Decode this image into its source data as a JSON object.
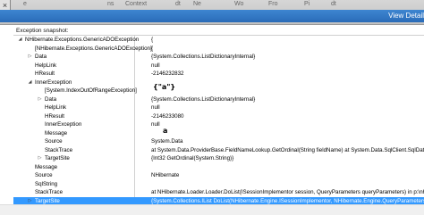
{
  "window": {
    "close_glyph": "×",
    "background_fragments": [
      "e",
      "ns",
      "Context",
      "dt",
      "Ne",
      "Wo",
      "Fro",
      "Pi",
      "dt"
    ],
    "title": "View Detail"
  },
  "snapshot_label": "Exception snapshot:",
  "rows": [
    {
      "indent": 0,
      "expander": "minus",
      "name": "NHibernate.Exceptions.GenericADOException",
      "value": "{"
    },
    {
      "indent": 1,
      "expander": "",
      "name": "[NHibernate.Exceptions.GenericADOException]",
      "value": "{"
    },
    {
      "indent": 1,
      "expander": "plus",
      "name": "Data",
      "value": "{System.Collections.ListDictionaryInternal}"
    },
    {
      "indent": 1,
      "expander": "",
      "name": "HelpLink",
      "value": "null"
    },
    {
      "indent": 1,
      "expander": "",
      "name": "HResult",
      "value": "-2146232832"
    },
    {
      "indent": 1,
      "expander": "minus",
      "name": "InnerException",
      "value": ""
    },
    {
      "indent": 2,
      "expander": "",
      "name": "[System.IndexOutOfRangeException]",
      "value": ""
    },
    {
      "indent": 2,
      "expander": "plus",
      "name": "Data",
      "value": "{System.Collections.ListDictionaryInternal}"
    },
    {
      "indent": 2,
      "expander": "",
      "name": "HelpLink",
      "value": "null"
    },
    {
      "indent": 2,
      "expander": "",
      "name": "HResult",
      "value": "-2146233080"
    },
    {
      "indent": 2,
      "expander": "",
      "name": "InnerException",
      "value": "null"
    },
    {
      "indent": 2,
      "expander": "",
      "name": "Message",
      "value": ""
    },
    {
      "indent": 2,
      "expander": "",
      "name": "Source",
      "value": "System.Data"
    },
    {
      "indent": 2,
      "expander": "",
      "name": "StackTrace",
      "value": "at System.Data.ProviderBase.FieldNameLookup.GetOrdinal(String fieldName)    at System.Data.SqlClient.SqlDataReade"
    },
    {
      "indent": 2,
      "expander": "plus",
      "name": "TargetSite",
      "value": "{Int32 GetOrdinal(System.String)}"
    },
    {
      "indent": 1,
      "expander": "",
      "name": "Message",
      "value": ""
    },
    {
      "indent": 1,
      "expander": "",
      "name": "Source",
      "value": "NHibernate"
    },
    {
      "indent": 1,
      "expander": "",
      "name": "SqlString",
      "value": ""
    },
    {
      "indent": 1,
      "expander": "",
      "name": "StackTrace",
      "value": "at NHibernate.Loader.Loader.DoList(ISessionImplementor session, QueryParameters queryParameters) in p:\\nhibernate"
    },
    {
      "indent": 1,
      "expander": "plus",
      "name": "TargetSite",
      "value": "{System.Collections.IList DoList(NHibernate.Engine.ISessionImplementor, NHibernate.Engine.QueryParameters)}",
      "selected": true
    }
  ],
  "annotations": {
    "inner_exception": "{\"a\"}",
    "message": "a"
  }
}
